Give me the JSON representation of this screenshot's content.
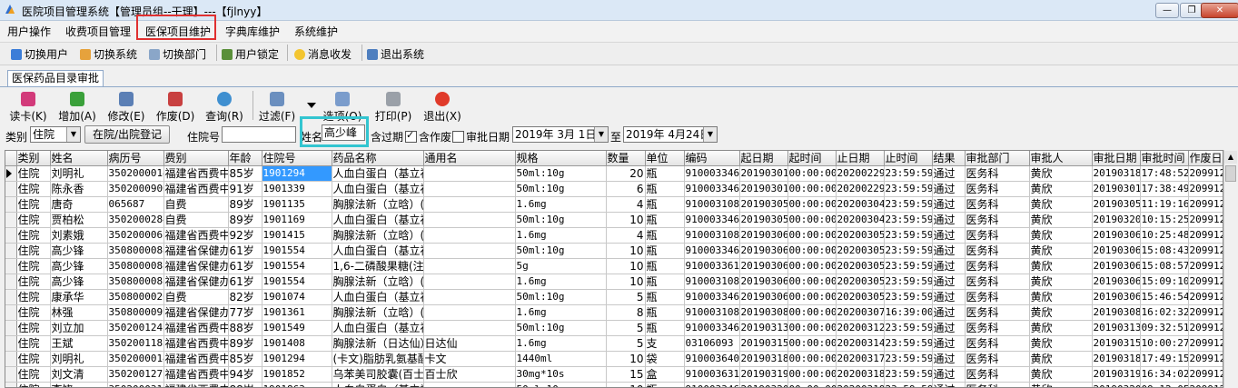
{
  "window": {
    "title": "医院项目管理系统【管理员组--干理】---【fjlnyy】"
  },
  "menu": [
    "用户操作",
    "收费项目管理",
    "医保项目维护",
    "字典库维护",
    "系统维护"
  ],
  "toolbar": [
    "切换用户",
    "切换系统",
    "切换部门",
    "用户锁定",
    "消息收发",
    "退出系统"
  ],
  "tab": {
    "label": "医保药品目录审批"
  },
  "actions": [
    "读卡(K)",
    "增加(A)",
    "修改(E)",
    "作废(D)",
    "查询(R)",
    "过滤(F)",
    "选项(O)",
    "打印(P)",
    "退出(X)"
  ],
  "filters": {
    "type_label": "类别",
    "type_value": "住院",
    "inout_button": "在院/出院登记",
    "inpatient_label": "住院号",
    "inpatient_value": "",
    "name_label": "姓名",
    "name_value": "高少峰",
    "include_expired": "含过期",
    "include_voided": "含作废",
    "approve_date_label": "审批日期",
    "date_from": "2019年 3月 1日",
    "to_label": "至",
    "date_to": "2019年 4月24日"
  },
  "grid": {
    "columns": [
      "类别",
      "姓名",
      "病历号",
      "费别",
      "年龄",
      "住院号",
      "药品名称",
      "通用名",
      "规格",
      "数量",
      "单位",
      "编码",
      "起日期",
      "起时间",
      "止日期",
      "止时间",
      "结果",
      "审批部门",
      "审批人",
      "审批日期",
      "审批时间",
      "作废日"
    ],
    "rows": [
      [
        "住院",
        "刘明礼",
        "350200001409",
        "福建省西费中",
        "85岁",
        "1901294",
        "人血白蛋白（基立福）",
        "",
        "50ml:10g",
        "20",
        "瓶",
        "910003346",
        "20190301",
        "00:00:00",
        "20200229",
        "23:59:59",
        "通过",
        "医务科",
        "黄欣",
        "20190318",
        "17:48:52",
        "20991231"
      ],
      [
        "住院",
        "陈永香",
        "350200090021",
        "福建省西费中",
        "91岁",
        "1901339",
        "人血白蛋白（基立福）",
        "",
        "50ml:10g",
        "6",
        "瓶",
        "910003346",
        "20190301",
        "00:00:00",
        "20200229",
        "23:59:59",
        "通过",
        "医务科",
        "黄欣",
        "20190301",
        "17:38:49",
        "20991231"
      ],
      [
        "住院",
        "唐奇",
        "065687",
        "自费",
        "89岁",
        "1901135",
        "胸腺法新（立晗）(注)",
        "",
        "1.6mg",
        "4",
        "瓶",
        "910003108",
        "20190305",
        "00:00:00",
        "20200304",
        "23:59:59",
        "通过",
        "医务科",
        "黄欣",
        "20190305",
        "11:19:16",
        "20991231"
      ],
      [
        "住院",
        "贾柏松",
        "350200028409",
        "自费",
        "89岁",
        "1901169",
        "人血白蛋白（基立福）",
        "",
        "50ml:10g",
        "10",
        "瓶",
        "910003346",
        "20190305",
        "00:00:00",
        "20200304",
        "23:59:59",
        "通过",
        "医务科",
        "黄欣",
        "20190320",
        "10:15:25",
        "20991231"
      ],
      [
        "住院",
        "刘素娥",
        "350200006125",
        "福建省西费中",
        "92岁",
        "1901415",
        "胸腺法新（立晗）(注)",
        "",
        "1.6mg",
        "4",
        "瓶",
        "910003108",
        "20190306",
        "00:00:00",
        "20200305",
        "23:59:59",
        "通过",
        "医务科",
        "黄欣",
        "20190306",
        "10:25:48",
        "20991231"
      ],
      [
        "住院",
        "高少锋",
        "350800008834",
        "福建省保健办",
        "61岁",
        "1901554",
        "人血白蛋白（基立福）",
        "",
        "50ml:10g",
        "10",
        "瓶",
        "910003346",
        "20190306",
        "00:00:00",
        "20200305",
        "23:59:59",
        "通过",
        "医务科",
        "黄欣",
        "20190306",
        "15:08:43",
        "20991231"
      ],
      [
        "住院",
        "高少锋",
        "350800008834",
        "福建省保健办",
        "61岁",
        "1901554",
        "1,6-二磷酸果糖(注)",
        "",
        "5g",
        "10",
        "瓶",
        "910003361",
        "20190306",
        "00:00:00",
        "20200305",
        "23:59:59",
        "通过",
        "医务科",
        "黄欣",
        "20190306",
        "15:08:57",
        "20991231"
      ],
      [
        "住院",
        "高少锋",
        "350800008834",
        "福建省保健办",
        "61岁",
        "1901554",
        "胸腺法新（立晗）(注)",
        "",
        "1.6mg",
        "10",
        "瓶",
        "910003108",
        "20190306",
        "00:00:00",
        "20200305",
        "23:59:59",
        "通过",
        "医务科",
        "黄欣",
        "20190306",
        "15:09:10",
        "20991231"
      ],
      [
        "住院",
        "康承华",
        "350800002611",
        "自费",
        "82岁",
        "1901074",
        "人血白蛋白（基立福）",
        "",
        "50ml:10g",
        "5",
        "瓶",
        "910003346",
        "20190306",
        "00:00:00",
        "20200305",
        "23:59:59",
        "通过",
        "医务科",
        "黄欣",
        "20190306",
        "15:46:54",
        "20991231"
      ],
      [
        "住院",
        "林强",
        "350800009901",
        "福建省保健办",
        "77岁",
        "1901361",
        "胸腺法新（立晗）(注)",
        "",
        "1.6mg",
        "8",
        "瓶",
        "910003108",
        "20190308",
        "00:00:00",
        "20200307",
        "16:39:00",
        "通过",
        "医务科",
        "黄欣",
        "20190308",
        "16:02:32",
        "20991231"
      ],
      [
        "住院",
        "刘立加",
        "350200124501",
        "福建省西费中",
        "88岁",
        "1901549",
        "人血白蛋白（基立福）",
        "",
        "50ml:10g",
        "5",
        "瓶",
        "910003346",
        "20190313",
        "00:00:00",
        "20200312",
        "23:59:59",
        "通过",
        "医务科",
        "黄欣",
        "20190313",
        "09:32:51",
        "20991231"
      ],
      [
        "住院",
        "王斌",
        "350200118501",
        "福建省西费中",
        "89岁",
        "1901408",
        "胸腺法新（日达仙）",
        "日达仙",
        "1.6mg",
        "5",
        "支",
        "03106093",
        "20190315",
        "00:00:00",
        "20200314",
        "23:59:59",
        "通过",
        "医务科",
        "黄欣",
        "20190315",
        "10:00:27",
        "20991231"
      ],
      [
        "住院",
        "刘明礼",
        "350200001409",
        "福建省西费中",
        "85岁",
        "1901294",
        "(卡文)脂肪乳氨基酸",
        "卡文",
        "1440ml",
        "10",
        "袋",
        "910003640",
        "20190318",
        "00:00:00",
        "20200317",
        "23:59:59",
        "通过",
        "医务科",
        "黄欣",
        "20190318",
        "17:49:15",
        "20991231"
      ],
      [
        "住院",
        "刘文清",
        "350200127101",
        "福建省西费中",
        "94岁",
        "1901852",
        "乌苯美司胶囊(百士欣)",
        "百士欣",
        "30mg*10s",
        "15",
        "盒",
        "910003631",
        "20190319",
        "00:00:00",
        "20200318",
        "23:59:59",
        "通过",
        "医务科",
        "黄欣",
        "20190319",
        "16:34:02",
        "20991231"
      ],
      [
        "住院",
        "李饶",
        "350200031101",
        "福建省西费中",
        "88岁",
        "1901863",
        "人血白蛋白（基立福）",
        "",
        "50ml:10g",
        "10",
        "瓶",
        "910003346",
        "20190320",
        "00:00:00",
        "20200319",
        "23:59:59",
        "通过",
        "医务科",
        "黄欣",
        "20190320",
        "09:12:05",
        "20991231"
      ]
    ]
  },
  "colors": {
    "menu_highlight": "#e03030",
    "name_highlight": "#33c5d0",
    "selected_cell": "#3399ff"
  },
  "icons": [
    "app-icon",
    "user-switch-icon",
    "system-switch-icon",
    "department-switch-icon",
    "user-lock-icon",
    "message-icon",
    "exit-system-icon",
    "read-card-icon",
    "add-icon",
    "edit-icon",
    "void-icon",
    "query-icon",
    "filter-icon",
    "options-icon",
    "print-icon",
    "exit-icon"
  ]
}
